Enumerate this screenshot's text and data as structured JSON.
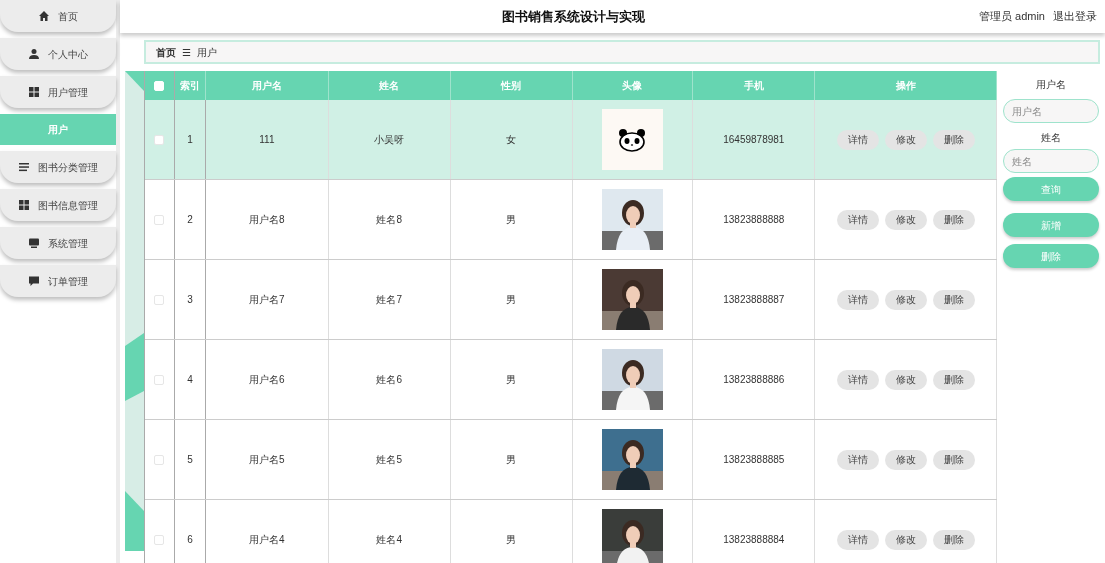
{
  "sidebar": {
    "items": [
      {
        "label": "首页",
        "selected": false
      },
      {
        "label": "个人中心",
        "selected": false
      },
      {
        "label": "用户管理",
        "selected": false
      },
      {
        "label": "用户",
        "selected": true
      },
      {
        "label": "图书分类管理",
        "selected": false
      },
      {
        "label": "图书信息管理",
        "selected": false
      },
      {
        "label": "系统管理",
        "selected": false
      },
      {
        "label": "订单管理",
        "selected": false
      }
    ]
  },
  "header": {
    "title": "图书销售系统设计与实现",
    "user": "管理员 admin",
    "logout": "退出登录"
  },
  "breadcrumb": {
    "home": "首页",
    "separator": "☰",
    "current": "用户"
  },
  "table": {
    "header_checked": false,
    "columns": [
      "索引",
      "用户名",
      "姓名",
      "性别",
      "头像",
      "手机",
      "操作"
    ],
    "rows": [
      {
        "kind": "panda",
        "selected": true,
        "checked": false,
        "index": "1",
        "username": "111",
        "name": "小吴呀",
        "gender": "女",
        "phone": "16459878981",
        "actions": [
          "详情",
          "修改",
          "删除"
        ]
      },
      {
        "kind": "picture",
        "selected": false,
        "checked": false,
        "index": "2",
        "username": "用户名8",
        "name": "姓名8",
        "gender": "男",
        "phone": "13823888888",
        "actions": [
          "详情",
          "修改",
          "删除"
        ]
      },
      {
        "kind": "picture",
        "selected": false,
        "checked": false,
        "index": "3",
        "username": "用户名7",
        "name": "姓名7",
        "gender": "男",
        "phone": "13823888887",
        "actions": [
          "详情",
          "修改",
          "删除"
        ]
      },
      {
        "kind": "picture",
        "selected": false,
        "checked": false,
        "index": "4",
        "username": "用户名6",
        "name": "姓名6",
        "gender": "男",
        "phone": "13823888886",
        "actions": [
          "详情",
          "修改",
          "删除"
        ]
      },
      {
        "kind": "picture",
        "selected": false,
        "checked": false,
        "index": "5",
        "username": "用户名5",
        "name": "姓名5",
        "gender": "男",
        "phone": "13823888885",
        "actions": [
          "详情",
          "修改",
          "删除"
        ]
      },
      {
        "kind": "picture",
        "selected": false,
        "checked": false,
        "index": "6",
        "username": "用户名4",
        "name": "姓名4",
        "gender": "男",
        "phone": "13823888884",
        "actions": [
          "详情",
          "修改",
          "删除"
        ]
      }
    ]
  },
  "search": {
    "fields": [
      {
        "label": "用户名",
        "placeholder": "用户名"
      },
      {
        "label": "姓名",
        "placeholder": "姓名"
      }
    ],
    "query": "查询",
    "add": "新增",
    "delete": "删除"
  }
}
